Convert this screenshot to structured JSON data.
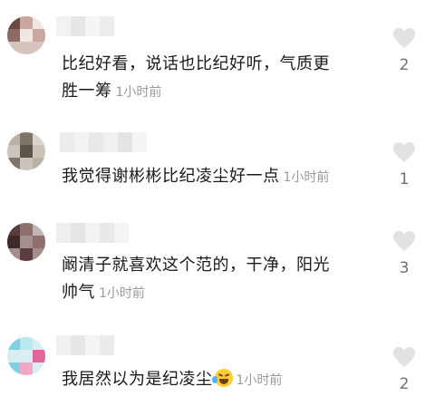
{
  "comments": [
    {
      "text_line1": "比纪好看，说话也比纪好听，气质更",
      "text_line2": "胜一筹",
      "time": "1小时前",
      "likes": "2",
      "avatar_colors": [
        "#6b4a45",
        "#c9a7a0",
        "#f0e6e2",
        "#8c6b66"
      ]
    },
    {
      "text_line1": "我觉得谢彬彬比纪凌尘好一点",
      "time": "1小时前",
      "likes": "1",
      "avatar_colors": [
        "#b8b1a6",
        "#7e7468",
        "#d9d4cc",
        "#5d544b"
      ]
    },
    {
      "text_line1": "阚清子就喜欢这个范的，干净，阳光",
      "text_line2": "帅气",
      "time": "1小时前",
      "likes": "3",
      "avatar_colors": [
        "#5a3d3c",
        "#8e6f6d",
        "#c2b6b4",
        "#3d2a2a"
      ]
    },
    {
      "text_line1": "我居然以为是纪凌尘",
      "time": "1小时前",
      "likes": "2",
      "emoji": "rolling-on-floor-laughing-icon",
      "avatar_colors": [
        "#7fd0e0",
        "#e0679a",
        "#b9e8f0",
        "#f2a6c4"
      ]
    }
  ],
  "colors": {
    "text": "#1a1a1a",
    "time": "#9a9a9a",
    "heart": "#e2e2e2",
    "count": "#6e6e6e"
  }
}
